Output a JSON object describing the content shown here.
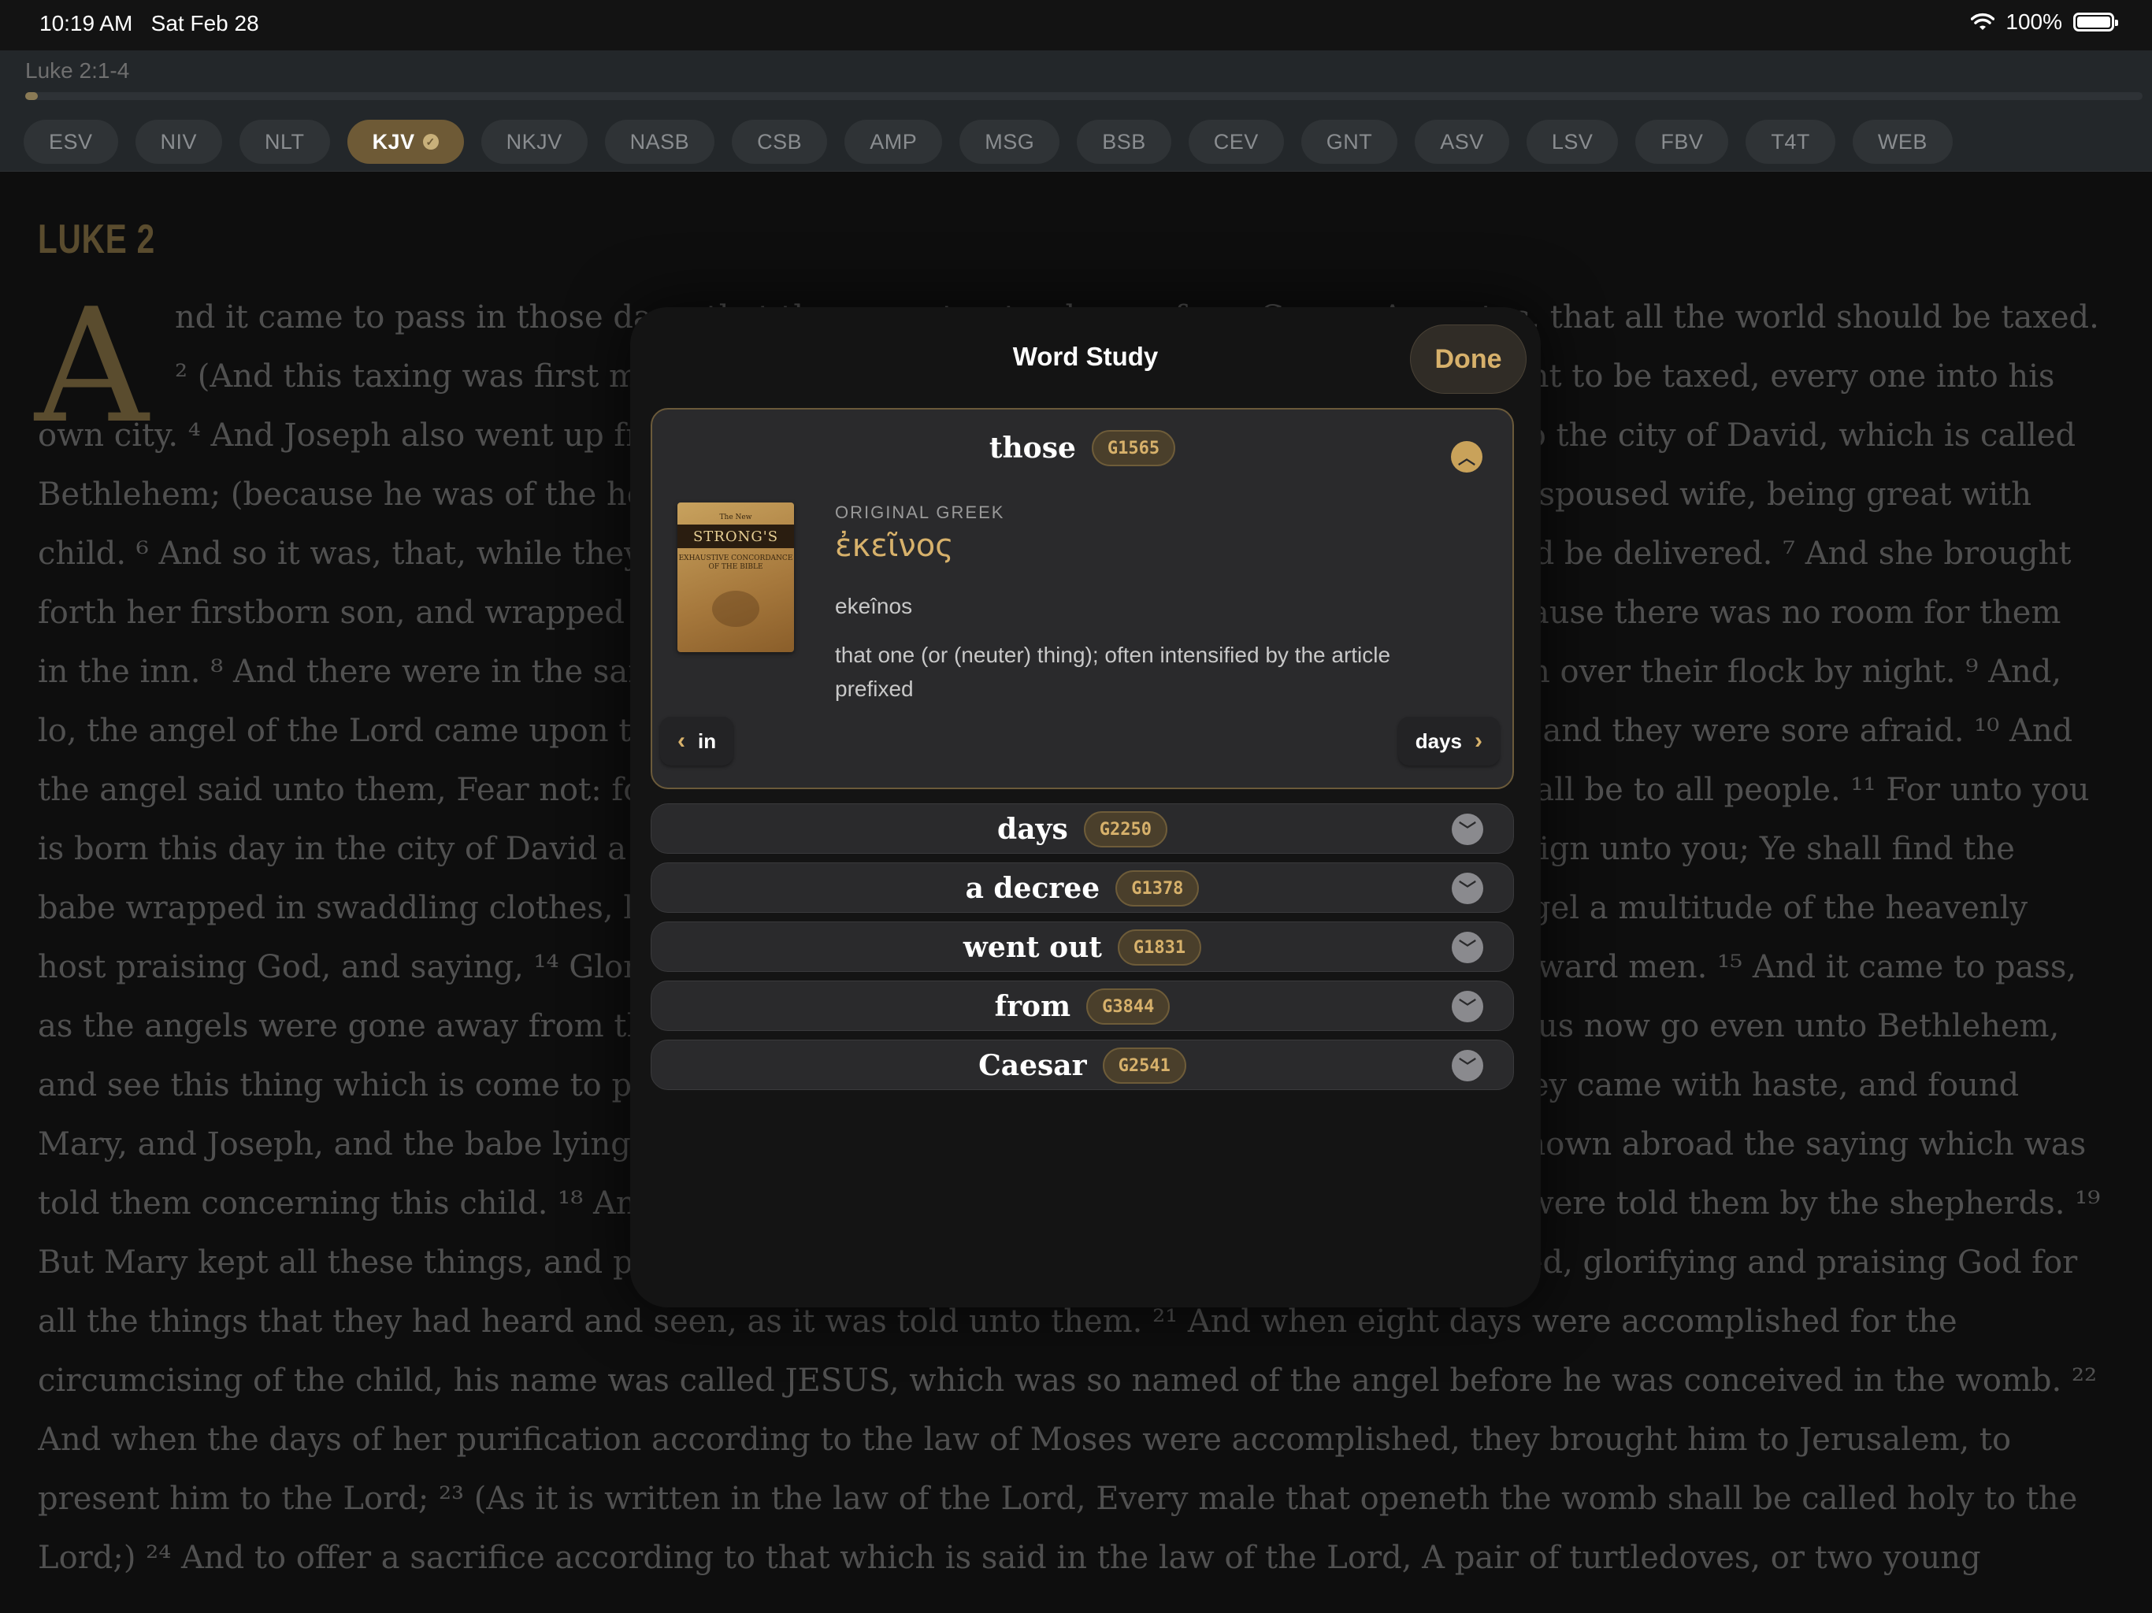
{
  "status_bar": {
    "time": "10:19 AM",
    "date": "Sat Feb 28",
    "battery": "100%",
    "icons": [
      "wifi-icon",
      "battery-icon"
    ]
  },
  "header": {
    "reference": "Luke 2:1-4",
    "progress_fraction": 0.006,
    "translations": [
      "ESV",
      "NIV",
      "NLT",
      "KJV",
      "NKJV",
      "NASB",
      "CSB",
      "AMP",
      "MSG",
      "BSB",
      "CEV",
      "GNT",
      "ASV",
      "LSV",
      "FBV",
      "T4T",
      "WEB"
    ],
    "active_translation": "KJV"
  },
  "scripture": {
    "chapter_title": "LUKE 2",
    "drop_cap": "A",
    "lines": [
      "nd it came to pass in those days, that there went out a decree from Caesar Augustus, that all the world should be taxed.",
      "² (And this taxing was first made when Cyrenius was governor of Syria.) ³ And all went to be taxed, every one into his",
      "own city. ⁴ And Joseph also went up from Galilee, out of the city of Nazareth, into Judaea, unto the city of David, which is called",
      "Bethlehem; (because he was of the house and lineage of David:) ⁵ To be taxed with Mary his espoused wife, being great with",
      "child. ⁶ And so it was, that, while they were there, the days were accomplished that she should be delivered. ⁷ And she brought",
      "forth her firstborn son, and wrapped him in swaddling clothes, and laid him in a manger; because there was no room for them",
      "in the inn. ⁸ And there were in the same country shepherds abiding in the field, keeping watch over their flock by night. ⁹ And,",
      "lo, the angel of the Lord came upon them, and the glory of the Lord shone round about them: and they were sore afraid. ¹⁰ And",
      "the angel said unto them, Fear not: for, behold, I bring you good tidings of great joy, which shall be to all people. ¹¹ For unto you",
      "is born this day in the city of David a Saviour, which is Christ the Lord. ¹² And this shall be a sign unto you; Ye shall find the",
      "babe wrapped in swaddling clothes, lying in a manger. ¹³ And suddenly there was with the angel a multitude of the heavenly",
      "host praising God, and saying, ¹⁴ Glory to God in the highest, and on earth peace, good will toward men. ¹⁵ And it came to pass,",
      "as the angels were gone away from them into heaven, the shepherds said one to another, Let us now go even unto Bethlehem,",
      "and see this thing which is come to pass, which the Lord hath made known unto us. ¹⁶ And they came with haste, and found",
      "Mary, and Joseph, and the babe lying in a manger. ¹⁷ And when they had seen it, they made known abroad the saying which was",
      "told them concerning this child. ¹⁸ And all they that heard it wondered at those things which were told them by the shepherds. ¹⁹",
      "But Mary kept all these things, and pondered them in her heart. ²⁰ And the shepherds returned, glorifying and praising God for",
      "all the things that they had heard and seen, as it was told unto them. ²¹ And when eight days were accomplished for the",
      "circumcising of the child, his name was called JESUS, which was so named of the angel before he was conceived in the womb. ²²",
      "And when the days of her purification according to the law of Moses were accomplished, they brought him to Jerusalem, to",
      "present him to the Lord; ²³ (As it is written in the law of the Lord, Every male that openeth the womb shall be called holy to the",
      "Lord;) ²⁴ And to offer a sacrifice according to that which is said in the law of the Lord, A pair of turtledoves, or two young"
    ]
  },
  "word_study": {
    "title": "Word Study",
    "done_label": "Done",
    "expanded": {
      "word": "those",
      "strongs": "G1565",
      "book_cover": {
        "line1": "The New",
        "line2": "STRONG'S",
        "line3": "EXHAUSTIVE CONCORDANCE OF THE BIBLE"
      },
      "label": "ORIGINAL GREEK",
      "greek": "ἐκεῖνος",
      "transliteration": "ekeînos",
      "definition": " that one (or (neuter) thing); often intensified by the article prefixed",
      "prev_word": "in",
      "next_word": "days"
    },
    "collapsed": [
      {
        "word": "days",
        "strongs": "G2250"
      },
      {
        "word": "a decree",
        "strongs": "G1378"
      },
      {
        "word": "went out",
        "strongs": "G1831"
      },
      {
        "word": "from",
        "strongs": "G3844"
      },
      {
        "word": "Caesar",
        "strongs": "G2541"
      }
    ]
  },
  "colors": {
    "accent_gold": "#d7b16b",
    "chapter_gold": "#8a7548",
    "background": "#161616",
    "card": "#2a2a2c"
  }
}
